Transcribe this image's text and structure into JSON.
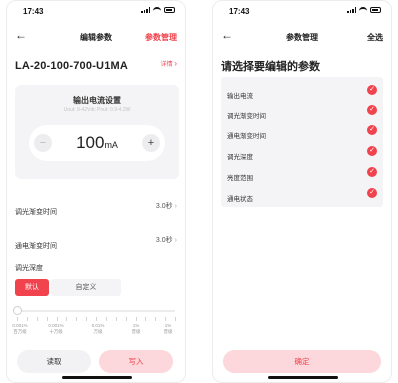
{
  "left": {
    "status_time": "17:43",
    "nav_title": "编辑参数",
    "nav_action": "参数管理",
    "product_name": "LA-20-100-700-U1MA",
    "detail_link": "详情",
    "card": {
      "title": "输出电流设置",
      "subtitle": "Uout: 9-42Vdc  Pout: 0.9-4.2W",
      "value": "100",
      "unit": "mA",
      "minus": "−",
      "plus": "+"
    },
    "settings": [
      {
        "label": "调光渐变时间",
        "value": "3.0秒"
      },
      {
        "label": "通电渐变时间",
        "value": "3.0秒"
      }
    ],
    "dimming_depth": {
      "label": "调光深度",
      "segments": [
        "默认",
        "自定义"
      ],
      "selected": "默认",
      "slider_fraction": 0,
      "slider_labels": [
        {
          "value": "0.001%",
          "desc": "百万级"
        },
        {
          "value": "0.001%",
          "desc": "十万级"
        },
        {
          "value": "0.01%",
          "desc": "万级"
        },
        {
          "value": "1%",
          "desc": "普级"
        },
        {
          "value": "1%",
          "desc": "普级"
        }
      ]
    },
    "buttons": {
      "read": "读取",
      "write": "写入"
    }
  },
  "right": {
    "status_time": "17:43",
    "nav_title": "参数管理",
    "nav_action": "全选",
    "select_title": "请选择要编辑的参数",
    "params": [
      {
        "label": "输出电流",
        "checked": true
      },
      {
        "label": "调光渐变时间",
        "checked": true
      },
      {
        "label": "通电渐变时间",
        "checked": true
      },
      {
        "label": "调光深度",
        "checked": true
      },
      {
        "label": "亮度范围",
        "checked": true
      },
      {
        "label": "通电状态",
        "checked": true
      }
    ],
    "confirm": "确定"
  },
  "colors": {
    "accent": "#f1434d",
    "accent_light": "#fcd7db",
    "card_bg": "#f4f4f6"
  },
  "icons": [
    "back-arrow-icon",
    "chevron-right-icon",
    "minus-icon",
    "plus-icon",
    "check-circle-icon",
    "signal-icon",
    "wifi-icon",
    "battery-icon"
  ]
}
